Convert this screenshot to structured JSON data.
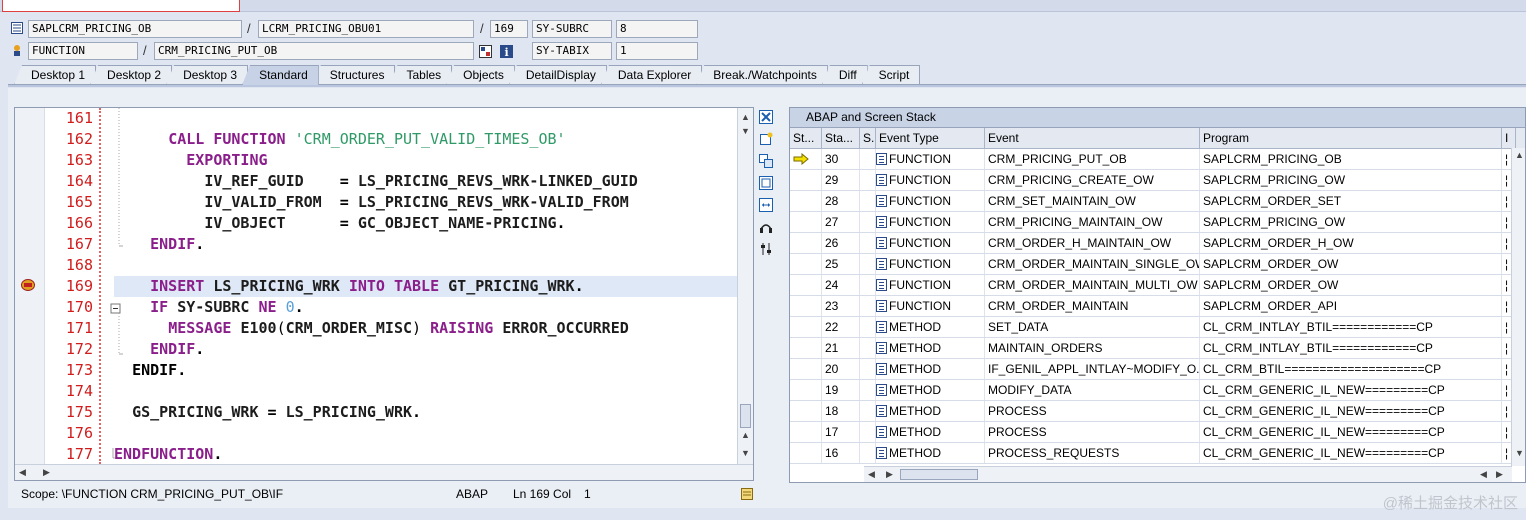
{
  "header": {
    "row1": {
      "main_program": "SAPLCRM_PRICING_OB",
      "include": "LCRM_PRICING_OBU01",
      "line": "169",
      "sysvar1_name": "SY-SUBRC",
      "sysvar1_value": "8"
    },
    "row2": {
      "event_type": "FUNCTION",
      "event": "CRM_PRICING_PUT_OB",
      "sysvar2_name": "SY-TABIX",
      "sysvar2_value": "1"
    },
    "sep": "/"
  },
  "tabs": [
    "Desktop 1",
    "Desktop 2",
    "Desktop 3",
    "Standard",
    "Structures",
    "Tables",
    "Objects",
    "DetailDisplay",
    "Data Explorer",
    "Break./Watchpoints",
    "Diff",
    "Script"
  ],
  "active_tab": "Standard",
  "editor": {
    "lines": [
      {
        "no": "161",
        "html": ""
      },
      {
        "no": "162",
        "html": "      <span class='kw'>CALL FUNCTION</span> <span class='str'>'CRM_ORDER_PUT_VALID_TIMES_OB'</span>"
      },
      {
        "no": "163",
        "html": "        <span class='kw'>EXPORTING</span>"
      },
      {
        "no": "164",
        "html": "          <span class='id'>IV_REF_GUID</span>    <span class='gr'>=</span> <span class='id'>LS_PRICING_REVS_WRK-LINKED_GUID</span>"
      },
      {
        "no": "165",
        "html": "          <span class='id'>IV_VALID_FROM</span>  <span class='gr'>=</span> <span class='id'>LS_PRICING_REVS_WRK-VALID_FROM</span>"
      },
      {
        "no": "166",
        "html": "          <span class='id'>IV_OBJECT</span>      <span class='gr'>=</span> <span class='id'>GC_OBJECT_NAME-PRICING</span><span class='gr'>.</span>"
      },
      {
        "no": "167",
        "html": "    <span class='kw'>ENDIF</span><span class='gr'>.</span>"
      },
      {
        "no": "168",
        "html": ""
      },
      {
        "no": "169",
        "html": "    <span class='kw'>INSERT</span> <span class='id'>LS_PRICING_WRK</span> <span class='kw'>INTO TABLE</span> <span class='id'>GT_PRICING_WRK</span><span class='gr'>.</span>"
      },
      {
        "no": "170",
        "html": "    <span class='kw'>IF</span> <span class='id'>SY-SUBRC</span> <span class='kw'>NE</span> <span class='num'>0</span><span class='gr'>.</span>"
      },
      {
        "no": "171",
        "html": "      <span class='kw'>MESSAGE</span> <span class='id'>E100</span>(<span class='id'>CRM_ORDER_MISC</span>) <span class='kw'>RAISING</span> <span class='id'>ERROR_OCCURRED</span>"
      },
      {
        "no": "172",
        "html": "    <span class='kw'>ENDIF</span><span class='gr'>.</span>"
      },
      {
        "no": "173",
        "html": "  <span class='gr'>ENDIF.</span>"
      },
      {
        "no": "174",
        "html": ""
      },
      {
        "no": "175",
        "html": "  <span class='id'>GS_PRICING_WRK</span> <span class='gr'>=</span> <span class='id'>LS_PRICING_WRK</span><span class='gr'>.</span>"
      },
      {
        "no": "176",
        "html": ""
      },
      {
        "no": "177",
        "html": "<span class='kw'>ENDFUNCTION</span><span class='gr'>.</span>"
      }
    ],
    "current_line": "169"
  },
  "status": {
    "scope": "Scope: \\FUNCTION CRM_PRICING_PUT_OB\\IF",
    "lang": "ABAP",
    "pos_label": "Ln 169 Col",
    "col": "1"
  },
  "stack": {
    "title": "ABAP and Screen Stack",
    "columns": [
      "St...",
      "Sta...",
      "S...",
      "Event Type",
      "Event",
      "Program",
      "I"
    ],
    "rows": [
      {
        "level": "30",
        "type": "FUNCTION",
        "event": "CRM_PRICING_PUT_OB",
        "program": "SAPLCRM_PRICING_OB",
        "current": true
      },
      {
        "level": "29",
        "type": "FUNCTION",
        "event": "CRM_PRICING_CREATE_OW",
        "program": "SAPLCRM_PRICING_OW"
      },
      {
        "level": "28",
        "type": "FUNCTION",
        "event": "CRM_SET_MAINTAIN_OW",
        "program": "SAPLCRM_ORDER_SET"
      },
      {
        "level": "27",
        "type": "FUNCTION",
        "event": "CRM_PRICING_MAINTAIN_OW",
        "program": "SAPLCRM_PRICING_OW"
      },
      {
        "level": "26",
        "type": "FUNCTION",
        "event": "CRM_ORDER_H_MAINTAIN_OW",
        "program": "SAPLCRM_ORDER_H_OW"
      },
      {
        "level": "25",
        "type": "FUNCTION",
        "event": "CRM_ORDER_MAINTAIN_SINGLE_OW",
        "program": "SAPLCRM_ORDER_OW"
      },
      {
        "level": "24",
        "type": "FUNCTION",
        "event": "CRM_ORDER_MAINTAIN_MULTI_OW",
        "program": "SAPLCRM_ORDER_OW"
      },
      {
        "level": "23",
        "type": "FUNCTION",
        "event": "CRM_ORDER_MAINTAIN",
        "program": "SAPLCRM_ORDER_API"
      },
      {
        "level": "22",
        "type": "METHOD",
        "event": "SET_DATA",
        "program": "CL_CRM_INTLAY_BTIL============CP"
      },
      {
        "level": "21",
        "type": "METHOD",
        "event": "MAINTAIN_ORDERS",
        "program": "CL_CRM_INTLAY_BTIL============CP"
      },
      {
        "level": "20",
        "type": "METHOD",
        "event": "IF_GENIL_APPL_INTLAY~MODIFY_O...",
        "program": "CL_CRM_BTIL====================CP"
      },
      {
        "level": "19",
        "type": "METHOD",
        "event": "MODIFY_DATA",
        "program": "CL_CRM_GENERIC_IL_NEW=========CP"
      },
      {
        "level": "18",
        "type": "METHOD",
        "event": "PROCESS",
        "program": "CL_CRM_GENERIC_IL_NEW=========CP"
      },
      {
        "level": "17",
        "type": "METHOD",
        "event": "PROCESS",
        "program": "CL_CRM_GENERIC_IL_NEW=========CP"
      },
      {
        "level": "16",
        "type": "METHOD",
        "event": "PROCESS_REQUESTS",
        "program": "CL_CRM_GENERIC_IL_NEW=========CP"
      }
    ]
  },
  "watermark": "@稀土掘金技术社区",
  "colors": {
    "line_number": "#d01c1c",
    "keyword": "#8a1e8a",
    "string": "#2f9a67",
    "number": "#5aa0d8",
    "highlight": "#dfe8f6"
  }
}
